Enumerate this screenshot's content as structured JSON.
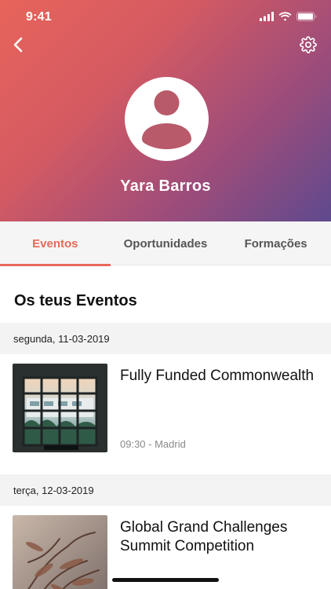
{
  "status_bar": {
    "time": "9:41",
    "icons": [
      "cellular-signal-icon",
      "wifi-icon",
      "battery-icon"
    ]
  },
  "header": {
    "back_icon": "chevron-left-icon",
    "settings_icon": "gear-icon",
    "profile_name": "Yara Barros",
    "avatar_icon": "person-silhouette-icon",
    "gradient_colors": [
      "#e8645b",
      "#5e4a8e"
    ]
  },
  "tabs": [
    {
      "label": "Eventos",
      "active": true
    },
    {
      "label": "Oportunidades",
      "active": false
    },
    {
      "label": "Formações",
      "active": false
    }
  ],
  "accent_color": "#e8695a",
  "section": {
    "title": "Os teus Eventos"
  },
  "event_groups": [
    {
      "date": "segunda, 11-03-2019",
      "events": [
        {
          "title": "Fully Funded Commonwealth",
          "meta": "09:30 - Madrid",
          "thumbnail": "window-building-photo"
        }
      ]
    },
    {
      "date": "terça, 12-03-2019",
      "events": [
        {
          "title": "Global Grand Challenges Summit Competition",
          "meta": "",
          "thumbnail": "dry-plant-photo"
        }
      ]
    }
  ]
}
